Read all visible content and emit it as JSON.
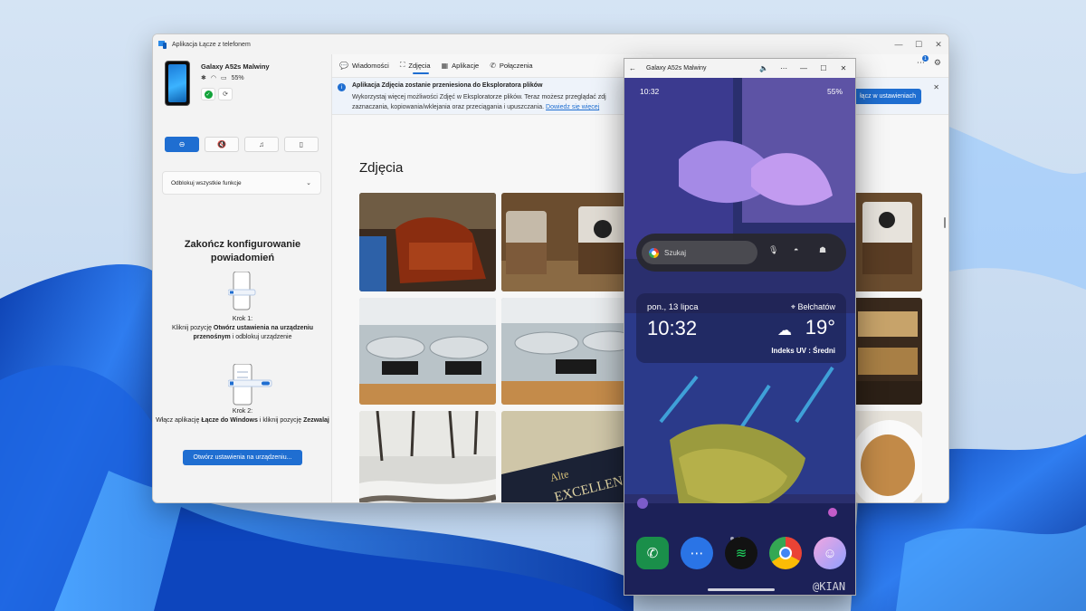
{
  "app": {
    "title": "Aplikacja Łącze z telefonem",
    "device_name": "Galaxy A52s Malwiny",
    "battery": "55%",
    "quick_actions": [
      "do-not-disturb",
      "mute",
      "media",
      "audio-output"
    ],
    "unlock_label": "Odblokuj wszystkie funkcje",
    "setup": {
      "title": "Zakończ konfigurowanie powiadomień",
      "step1_label": "Krok 1:",
      "step1_pre": "Kliknij pozycję ",
      "step1_bold": "Otwórz ustawienia na urządzeniu przenośnym",
      "step1_post": " i odblokuj urządzenie",
      "step2_label": "Krok 2:",
      "step2_pre": "Włącz aplikację ",
      "step2_bold": "Łącze do Windows",
      "step2_mid": " i kliknij pozycję ",
      "step2_bold2": "Zezwalaj",
      "button": "Otwórz ustawienia na urządzeniu..."
    },
    "tabs": [
      {
        "label": "Wiadomości",
        "icon": "chat-icon",
        "active": false
      },
      {
        "label": "Zdjęcia",
        "icon": "photo-icon",
        "active": true
      },
      {
        "label": "Aplikacje",
        "icon": "apps-icon",
        "active": false
      },
      {
        "label": "Połączenia",
        "icon": "phone-icon",
        "active": false
      }
    ],
    "notifications_badge": "1",
    "banner": {
      "title": "Aplikacja Zdjęcia zostanie przeniesiona do Eksploratora plików",
      "text": "Wykorzystaj więcej możliwości Zdjęć w Eksploratorze plików. Teraz możesz przeglądać zdj",
      "text2": "zaznaczania, kopiowania/wklejania oraz przeciągania i upuszczania.",
      "link": "Dowiedz się więcej",
      "button": "łącz w ustawieniach"
    },
    "section_title": "Zdjęcia"
  },
  "phone": {
    "window_title": "Galaxy A52s Malwiny",
    "status_time": "10:32",
    "status_battery": "55%",
    "search_placeholder": "Szukaj",
    "weather": {
      "date": "pon., 13 lipca",
      "time": "10:32",
      "city": "Bełchatów",
      "temp": "19°",
      "uv": "Indeks UV : Średni"
    },
    "dock": [
      "phone-app",
      "messages-app",
      "spotify-app",
      "chrome-app",
      "discord-app"
    ]
  },
  "watermark": "@KIAN",
  "colors": {
    "accent": "#1f6ed1",
    "wallpaper": "#1a5fd6"
  }
}
